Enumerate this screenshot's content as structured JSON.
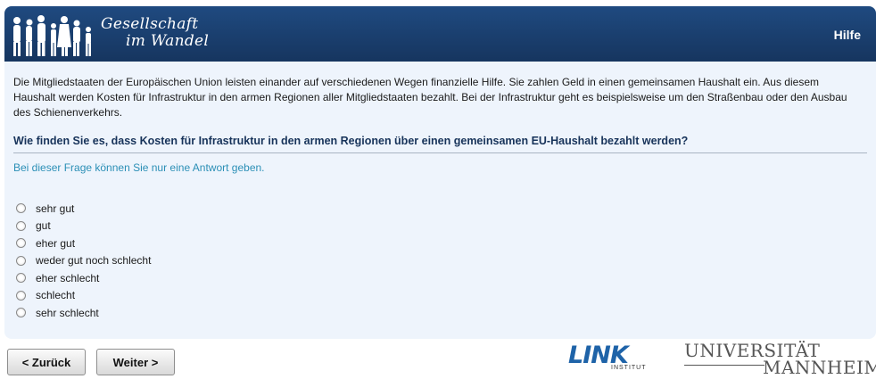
{
  "header": {
    "brand_line1": "Gesellschaft",
    "brand_line2": "im Wandel",
    "help_label": "Hilfe",
    "logo_icon": "people-silhouette-icon",
    "colors": {
      "header_bg": "#1f4a80",
      "panel_bg": "#eef4fc"
    }
  },
  "intro_text": "Die Mitgliedstaaten der Europäischen Union leisten einander auf verschiedenen Wegen finanzielle Hilfe. Sie zahlen Geld in einen gemeinsamen Haushalt ein. Aus diesem Haushalt werden Kosten für Infrastruktur in den armen Regionen aller Mitgliedstaaten bezahlt. Bei der Infrastruktur geht es beispielsweise um den Straßenbau oder den Ausbau des Schienenverkehrs.",
  "question": "Wie finden Sie es, dass Kosten für Infrastruktur in den armen Regionen über einen gemeinsamen EU-Haushalt bezahlt werden?",
  "instruction": "Bei dieser Frage können Sie nur eine Antwort geben.",
  "options": [
    {
      "label": "sehr gut",
      "selected": false
    },
    {
      "label": "gut",
      "selected": false
    },
    {
      "label": "eher gut",
      "selected": false
    },
    {
      "label": "weder gut noch schlecht",
      "selected": false
    },
    {
      "label": "eher schlecht",
      "selected": false
    },
    {
      "label": "schlecht",
      "selected": false
    },
    {
      "label": "sehr schlecht",
      "selected": false
    }
  ],
  "nav": {
    "back_label": "< Zurück",
    "next_label": "Weiter >"
  },
  "footer": {
    "link_logo_word": "LINK",
    "link_logo_sub": "INSTITUT",
    "university_line1": "UNIVERSITÄT",
    "university_line2": "MANNHEIM"
  }
}
